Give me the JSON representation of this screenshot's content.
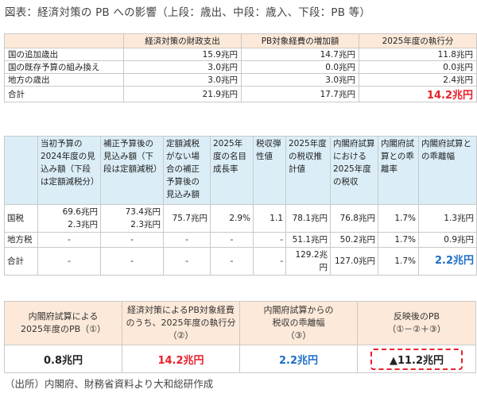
{
  "title": "図表：経済対策の PB への影響（上段：歳出、中段：歳入、下段：PB 等）",
  "table1": {
    "headers": [
      "",
      "経済対策の財政支出",
      "PB対象経費の増加額",
      "2025年度の執行分"
    ],
    "rows": [
      {
        "label": "国の追加歳出",
        "c1": "15.9兆円",
        "c2": "14.7兆円",
        "c3": "11.8兆円"
      },
      {
        "label": "国の既存予算の組み換え",
        "c1": "3.0兆円",
        "c2": "0.0兆円",
        "c3": "0.0兆円"
      },
      {
        "label": "地方の歳出",
        "c1": "3.0兆円",
        "c2": "3.0兆円",
        "c3": "2.4兆円"
      },
      {
        "label": "合計",
        "c1": "21.9兆円",
        "c2": "17.7兆円",
        "c3": "14.2兆円"
      }
    ]
  },
  "table2": {
    "headers": [
      "",
      "当初予算の2024年度の見込み額（下段は定額減税分）",
      "補正予算後の見込み額（下段は定額減税）",
      "定額減税がない場合の補正予算後の見込み額",
      "2025年度の名目成長率",
      "税収弾性値",
      "2025年度の税収推計値",
      "内閣府試算における2025年度の税収",
      "内閣府試算との乖離率",
      "内閣府試算との乖離幅"
    ],
    "kokuzei": {
      "label": "国税",
      "c1a": "69.6兆円",
      "c1b": "2.3兆円",
      "c2a": "73.4兆円",
      "c2b": "2.3兆円",
      "c3": "75.7兆円",
      "c4": "2.9%",
      "c5": "1.1",
      "c6": "78.1兆円",
      "c7": "76.8兆円",
      "c8": "1.7%",
      "c9": "1.3兆円"
    },
    "chihou": {
      "label": "地方税",
      "c1": "-",
      "c2": "-",
      "c3": "-",
      "c4": "-",
      "c5": "-",
      "c6": "51.1兆円",
      "c7": "50.2兆円",
      "c8": "1.7%",
      "c9": "0.9兆円"
    },
    "total": {
      "label": "合計",
      "c1": "-",
      "c2": "-",
      "c3": "-",
      "c4": "-",
      "c5": "-",
      "c6": "129.2兆円",
      "c7": "127.0兆円",
      "c8": "1.7%",
      "c9": "2.2兆円"
    }
  },
  "table3": {
    "h1a": "内閣府試算による",
    "h1b": "2025年度のPB（①）",
    "h2a": "経済対策によるPB対象経費",
    "h2b": "のうち、2025年度の執行分",
    "h2c": "（②）",
    "h3a": "内閣府試算からの",
    "h3b": "税収の乖離幅",
    "h3c": "（③）",
    "h4a": "反映後のPB",
    "h4b": "（①－②＋③）",
    "v1": "0.8兆円",
    "v2": "14.2兆円",
    "v3": "2.2兆円",
    "v4": "▲11.2兆円"
  },
  "source": "（出所）内閣府、財務省資料より大和総研作成",
  "colors": {
    "red": "#e8202a",
    "blue": "#1f6fc7",
    "peach_header": "#fde9d9",
    "blue_header": "#dbeef7"
  }
}
